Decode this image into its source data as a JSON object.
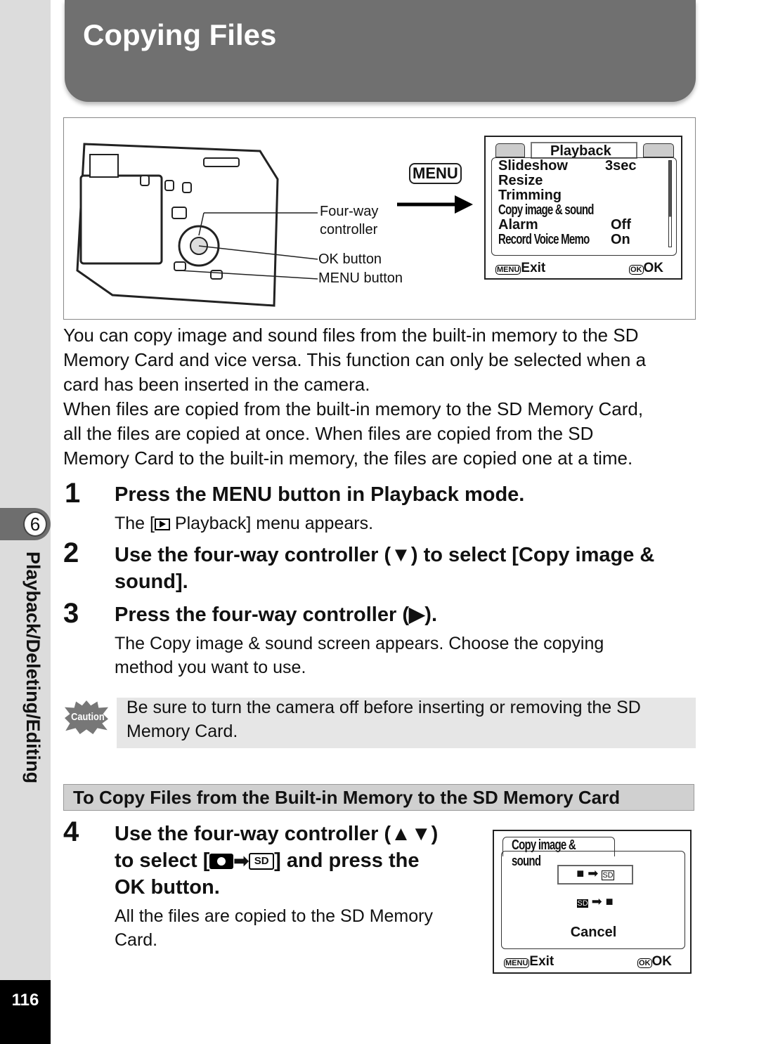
{
  "header": {
    "title": "Copying Files"
  },
  "sidebar": {
    "chapter_number": "6",
    "chapter_label": "Playback/Deleting/Editing",
    "page_number": "116"
  },
  "figure": {
    "menu_key": "MENU",
    "labels": {
      "four_way": "Four-way",
      "controller": "controller",
      "ok_button": "OK button",
      "menu_button": "MENU button"
    },
    "screen": {
      "tab": "Playback",
      "items": [
        {
          "label": "Slideshow",
          "value": "3sec"
        },
        {
          "label": "Resize",
          "value": ""
        },
        {
          "label": "Trimming",
          "value": ""
        },
        {
          "label": "Copy image & sound",
          "value": ""
        },
        {
          "label": "Alarm",
          "value": "Off"
        },
        {
          "label": "Record Voice Memo",
          "value": "On"
        }
      ],
      "menu_key": "MENU",
      "exit": "Exit",
      "ok_key": "OK",
      "ok": "OK"
    }
  },
  "intro": [
    "You can copy image and sound files from the built-in memory to the SD",
    "Memory Card and vice versa. This function can only be selected when a",
    "card has been inserted in the camera.",
    "When files are copied from the built-in memory to the SD Memory Card,",
    "all the files are copied at once. When files are copied from the SD",
    "Memory Card to the built-in memory, the files are copied one at a time."
  ],
  "steps": [
    {
      "n": "1",
      "heading": "Press the MENU button in Playback mode.",
      "body_pre": "The [",
      "body_post": " Playback] menu appears."
    },
    {
      "n": "2",
      "heading1": "Use the four-way controller (▼) to select [Copy image &",
      "heading2": "sound]."
    },
    {
      "n": "3",
      "heading": "Press the four-way controller (▶).",
      "body1": "The Copy image & sound screen appears. Choose the copying",
      "body2": "method you want to use."
    },
    {
      "n": "4",
      "heading1": "Use the four-way controller (▲▼)",
      "heading2_pre": "to select [",
      "heading2_post": "] and press the",
      "heading3": "OK button.",
      "body1": "All the files are copied to the SD Memory",
      "body2": "Card."
    }
  ],
  "caution": {
    "icon_text": "Caution",
    "text1": "Be sure to turn the camera off before inserting or removing the SD",
    "text2": "Memory Card."
  },
  "section_title": "To Copy Files from the Built-in Memory to the SD Memory Card",
  "copy_screen": {
    "title": "Copy image & sound",
    "cancel": "Cancel",
    "menu_key": "MENU",
    "exit": "Exit",
    "ok_key": "OK",
    "ok": "OK",
    "sd": "SD"
  }
}
